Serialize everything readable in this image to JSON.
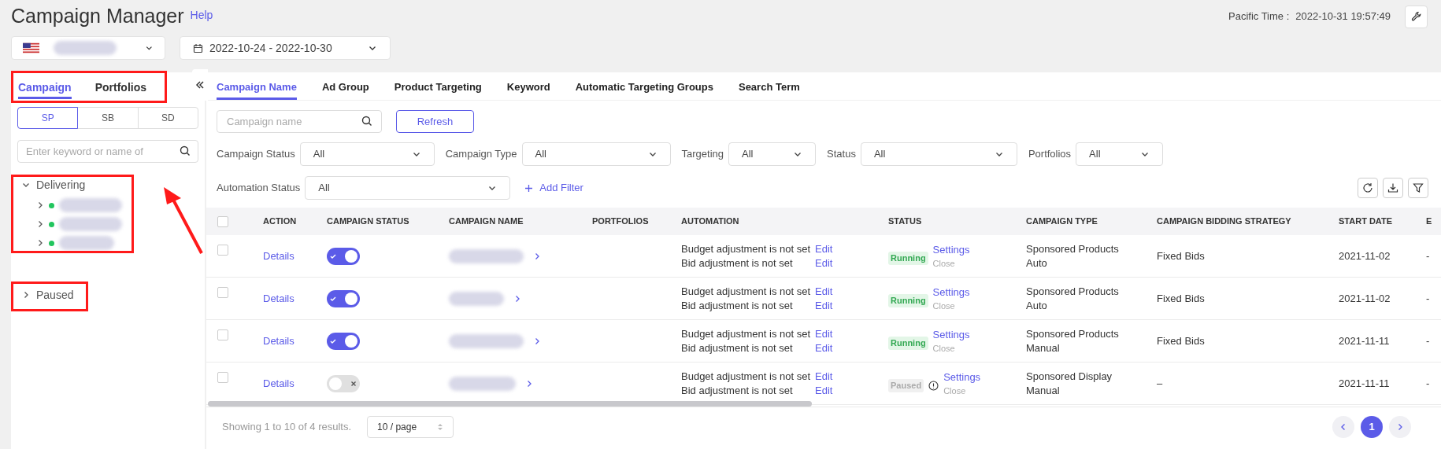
{
  "header": {
    "title": "Campaign Manager",
    "help": "Help",
    "time_label": "Pacific Time :",
    "time": "2022-10-31 19:57:49"
  },
  "date_range": "2022-10-24 - 2022-10-30",
  "sidebar": {
    "tabs": [
      {
        "label": "Campaign",
        "selected": true
      },
      {
        "label": "Portfolios",
        "selected": false
      }
    ],
    "ad_types": [
      {
        "label": "SP",
        "selected": true
      },
      {
        "label": "SB",
        "selected": false
      },
      {
        "label": "SD",
        "selected": false
      }
    ],
    "search_placeholder": "Enter keyword or name of",
    "groups": [
      {
        "label": "Delivering",
        "expanded": true,
        "children": [
          {
            "color": "#22c55e"
          },
          {
            "color": "#22c55e"
          },
          {
            "color": "#22c55e"
          }
        ]
      },
      {
        "label": "Paused",
        "expanded": false
      }
    ]
  },
  "main": {
    "tabs": [
      {
        "label": "Campaign Name",
        "selected": true
      },
      {
        "label": "Ad Group",
        "selected": false
      },
      {
        "label": "Product Targeting",
        "selected": false
      },
      {
        "label": "Keyword",
        "selected": false
      },
      {
        "label": "Automatic Targeting Groups",
        "selected": false
      },
      {
        "label": "Search Term",
        "selected": false
      }
    ],
    "search_placeholder": "Campaign name",
    "refresh": "Refresh",
    "filters": [
      {
        "label": "Campaign Status",
        "value": "All"
      },
      {
        "label": "Campaign Type",
        "value": "All"
      },
      {
        "label": "Targeting",
        "value": "All"
      },
      {
        "label": "Status",
        "value": "All"
      },
      {
        "label": "Portfolios",
        "value": "All"
      },
      {
        "label": "Automation Status",
        "value": "All"
      }
    ],
    "add_filter": "Add Filter",
    "table": {
      "select_all_checked": false,
      "columns": [
        "ACTION",
        "CAMPAIGN STATUS",
        "CAMPAIGN NAME",
        "PORTFOLIOS",
        "AUTOMATION",
        "STATUS",
        "CAMPAIGN TYPE",
        "CAMPAIGN BIDDING STRATEGY",
        "START DATE",
        "E"
      ],
      "rows": [
        {
          "checked": false,
          "action": "Details",
          "on": true,
          "automation": [
            {
              "text": "Budget adjustment is not set",
              "link": "Edit"
            },
            {
              "text": "Bid adjustment is not set",
              "link": "Edit"
            }
          ],
          "status": {
            "kind": "running",
            "label": "Running"
          },
          "settings": "Settings",
          "close": "Close",
          "type": "Sponsored Products Auto",
          "bidding": "Fixed Bids",
          "start_date": "2021-11-02",
          "column_10": "-"
        },
        {
          "checked": false,
          "action": "Details",
          "on": true,
          "automation": [
            {
              "text": "Budget adjustment is not set",
              "link": "Edit"
            },
            {
              "text": "Bid adjustment is not set",
              "link": "Edit"
            }
          ],
          "status": {
            "kind": "running",
            "label": "Running"
          },
          "settings": "Settings",
          "close": "Close",
          "type": "Sponsored Products Auto",
          "bidding": "Fixed Bids",
          "start_date": "2021-11-02",
          "column_10": "-"
        },
        {
          "checked": false,
          "action": "Details",
          "on": true,
          "automation": [
            {
              "text": "Budget adjustment is not set",
              "link": "Edit"
            },
            {
              "text": "Bid adjustment is not set",
              "link": "Edit"
            }
          ],
          "status": {
            "kind": "running",
            "label": "Running"
          },
          "settings": "Settings",
          "close": "Close",
          "type": "Sponsored Products Manual",
          "bidding": "Fixed Bids",
          "start_date": "2021-11-11",
          "column_10": "-"
        },
        {
          "checked": false,
          "action": "Details",
          "on": false,
          "automation": [
            {
              "text": "Budget adjustment is not set",
              "link": "Edit"
            },
            {
              "text": "Bid adjustment is not set",
              "link": "Edit"
            }
          ],
          "status": {
            "kind": "paused",
            "label": "Paused"
          },
          "settings": "Settings",
          "close": "Close",
          "type": "Sponsored Display Manual",
          "bidding": "–",
          "start_date": "2021-11-11",
          "column_10": "-"
        }
      ]
    },
    "footer": {
      "summary": "Showing 1 to 10 of 4 results.",
      "page_size": "10 / page",
      "pages": [
        {
          "label": "1",
          "selected": true
        }
      ]
    }
  }
}
